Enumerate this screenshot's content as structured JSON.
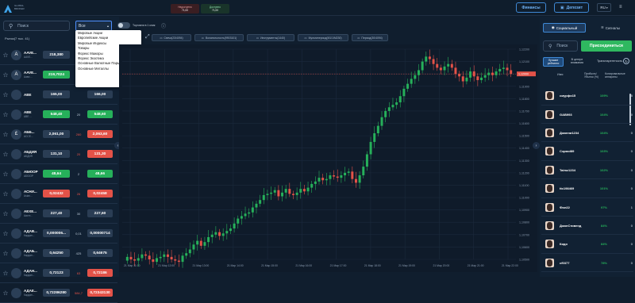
{
  "header": {
    "logo_text": "GLOBAL BROKER",
    "tabs": [
      {
        "label": "Недоступно",
        "value": "71,00",
        "color": "#e35248"
      },
      {
        "label": "Доступно",
        "value": "71,00",
        "color": "#26b05a"
      },
      {
        "label": "Средства",
        "value": "71,00",
        "color": "#8fa5bd"
      }
    ],
    "finance_label": "Финансы",
    "deposit_label": "Депозит",
    "language": "RU"
  },
  "left": {
    "search_placeholder": "Поиск",
    "filter_value": "Все",
    "toggle_label": "Торговля в 1 клик",
    "col_market": "Рынок(7 тыс. 41)",
    "col_price": "Продажа",
    "dropdown_items": [
      "Мировые Акции",
      "Европейские Акции",
      "Мировые Индексы",
      "Товары",
      "Форекс Мажоры",
      "Форекс Экзотика",
      "Основные Валютные Пары Форекс",
      "Основные Металлы"
    ],
    "rows": [
      {
        "flag": "A",
        "name": "AAVE...",
        "sub": "AAVE...",
        "bid": "218,380",
        "spread": "",
        "ask": "",
        "bid_color": "n"
      },
      {
        "flag": "A",
        "name": "AAVE...",
        "sub": "Аави ...",
        "bid": "219,7024",
        "spread": "",
        "ask": "",
        "bid_color": "g"
      },
      {
        "flag": "",
        "name": "ABE",
        "sub": "",
        "bid": "165,00",
        "spread": "",
        "ask": "166,00",
        "bid_color": "n"
      },
      {
        "flag": "",
        "name": "ABE",
        "sub": "ABE ...",
        "bid": "548,40",
        "spread": "20",
        "ask": "548,60",
        "bid_color": "g"
      },
      {
        "flag": "£",
        "name": "АББ...",
        "sub": "ACCE...",
        "bid": "2,061,00",
        "spread": "260",
        "ask": "2,063,60",
        "bid_color": "n"
      },
      {
        "flag": "",
        "name": "АБДИЯ",
        "sub": "АБДИЯ",
        "bid": "131,10",
        "spread": "20",
        "ask": "131,30",
        "bid_color": "n"
      },
      {
        "flag": "",
        "name": "АБЮОР",
        "sub": "АБЮОР",
        "bid": "48,64",
        "spread": "2",
        "ask": "48,66",
        "bid_color": "g"
      },
      {
        "flag": "",
        "name": "АСНИ...",
        "sub": "Аsian...",
        "bid": "0,02432",
        "spread": "26",
        "ask": "0,02458",
        "bid_color": "r"
      },
      {
        "flag": "",
        "name": "АЕХЕ...",
        "sub": "Аксте...",
        "bid": "227,40",
        "spread": "30",
        "ask": "227,60",
        "bid_color": "n"
      },
      {
        "flag": "",
        "name": "АДАВ...",
        "sub": "Кардан...",
        "bid": "0,000006...",
        "spread": "0,01",
        "ask": "0,00000714",
        "bid_color": "n"
      },
      {
        "flag": "",
        "name": "АДАБ...",
        "sub": "Кардан...",
        "bid": "0,64250",
        "spread": "425",
        "ask": "0,64675",
        "bid_color": "n"
      },
      {
        "flag": "",
        "name": "АДАН...",
        "sub": "Кардан...",
        "bid": "0,72123",
        "spread": "63",
        "ask": "0,72186",
        "bid_color": "n"
      },
      {
        "flag": "",
        "name": "АДАЕ...",
        "sub": "Кардан...",
        "bid": "0,72286280",
        "spread": "584,7",
        "ask": "0,72343130",
        "bid_color": "n"
      }
    ]
  },
  "chart_toolbar": {
    "items": [
      "Свеча(23/4094)",
      "Волатильность(9903101)",
      "Инструменты(1440)",
      "Мультипериод(М1/1/М230)",
      "Период(30/4094)"
    ]
  },
  "chart_data": {
    "type": "candlestick",
    "x_ticks": [
      "21 Мар 11:00",
      "21 Мар 12:00",
      "21 Мар 13:00",
      "21 Мар 14:00",
      "21 Мар 15:00",
      "21 Мар 16:00",
      "21 Мар 17:00",
      "21 Мар 18:00",
      "21 Мар 19:00",
      "21 Мар 20:00",
      "21 Мар 21:00",
      "21 Мар 22:00"
    ],
    "y_ticks": [
      "1,12200",
      "1,12100",
      "1,12000",
      "1,11900",
      "1,11800",
      "1,11700",
      "1,11600",
      "1,11500",
      "1,11400",
      "1,11300",
      "1,11200",
      "1,11100",
      "1,11000",
      "1,10900",
      "1,10800",
      "1,10700",
      "1,10600",
      "1,10500"
    ],
    "y_range": [
      1.105,
      1.122
    ],
    "current_price": "1,12000",
    "up_color": "#26b05a",
    "down_color": "#e35248",
    "closes": [
      1.1052,
      1.105,
      1.1049,
      1.1051,
      1.1054,
      1.1053,
      1.105,
      1.1048,
      1.1051,
      1.1052,
      1.1054,
      1.1052,
      1.105,
      1.1049,
      1.1048,
      1.1053,
      1.1055,
      1.1058,
      1.1062,
      1.1065,
      1.1061,
      1.1064,
      1.1068,
      1.107,
      1.1072,
      1.1069,
      1.1071,
      1.1073,
      1.1075,
      1.1079,
      1.1083,
      1.1085,
      1.1087,
      1.1088,
      1.1092,
      1.1095,
      1.1098,
      1.1102,
      1.1103,
      1.1104,
      1.1106,
      1.1101,
      1.1104,
      1.1107,
      1.1103,
      1.1102,
      1.1104,
      1.1107,
      1.1105,
      1.1108,
      1.1111,
      1.1113,
      1.1116,
      1.1114,
      1.1115,
      1.1118,
      1.1117,
      1.1116,
      1.1118,
      1.112,
      1.1121,
      1.1115,
      1.1112,
      1.1118,
      1.1125,
      1.1135,
      1.1145,
      1.1152,
      1.1158,
      1.1165,
      1.117,
      1.1173,
      1.1175,
      1.1177,
      1.1182,
      1.1188,
      1.1192,
      1.1196,
      1.1199,
      1.1203,
      1.121,
      1.1214,
      1.1212,
      1.1208,
      1.1205,
      1.1203,
      1.1206,
      1.1208,
      1.1205,
      1.12,
      1.1198,
      1.1194,
      1.1197,
      1.1202,
      1.1198,
      1.1195,
      1.1197,
      1.1199,
      1.1201,
      1.1199,
      1.1202,
      1.1204,
      1.1205,
      1.1203,
      1.12
    ]
  },
  "right": {
    "tab_social": "Социальный",
    "tab_signals": "Сигналы",
    "search_placeholder": "Поиск",
    "join_label": "Присоединиться",
    "filter_top": "Лучшие рейтинги",
    "filter_mid": "В центре внимания",
    "filter_transparent": "Транспарентность",
    "col_name": "Имя",
    "col_profit": "Прибыль/Убыток (%)",
    "col_copiers": "Копировальные аппараты",
    "rows": [
      {
        "name": "смурфи15",
        "pct": "109%",
        "count": "5"
      },
      {
        "name": "GAB993",
        "pct": "104%",
        "count": "0"
      },
      {
        "name": "Джонни1234",
        "pct": "104%",
        "count": "0"
      },
      {
        "name": "Сэрмоl89",
        "pct": "103%",
        "count": "0"
      },
      {
        "name": "Taimz1234",
        "pct": "102%",
        "count": "0"
      },
      {
        "name": "ttc198469",
        "pct": "101%",
        "count": "0"
      },
      {
        "name": "Фил22",
        "pct": "97%",
        "count": "1"
      },
      {
        "name": "ДжонСтивенд",
        "pct": "84%",
        "count": "0"
      },
      {
        "name": "Кидо",
        "pct": "84%",
        "count": "0"
      },
      {
        "name": "cf0377",
        "pct": "78%",
        "count": "0"
      }
    ]
  }
}
